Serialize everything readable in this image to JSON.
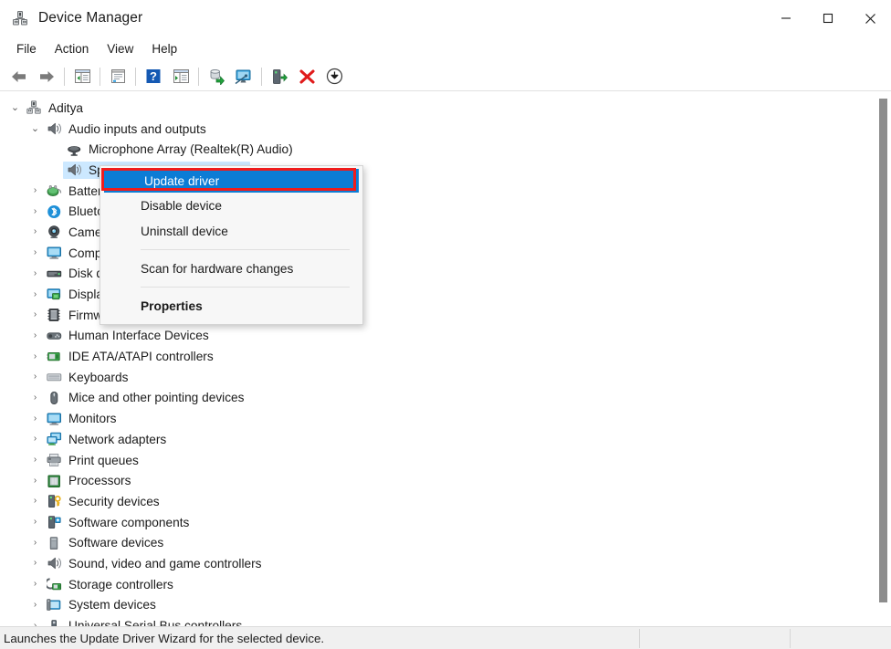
{
  "window": {
    "title": "Device Manager",
    "icon": "device-manager-icon",
    "minimize_label": "─",
    "maximize_label": "☐",
    "close_label": "✕"
  },
  "menubar": {
    "items": [
      {
        "label": "File"
      },
      {
        "label": "Action"
      },
      {
        "label": "View"
      },
      {
        "label": "Help"
      }
    ]
  },
  "toolbar": {
    "buttons": [
      {
        "name": "back-arrow-icon",
        "tip": "Back"
      },
      {
        "name": "forward-arrow-icon",
        "tip": "Forward"
      },
      {
        "name": "show-hide-console-tree-icon",
        "tip": "Show/Hide Console Tree"
      },
      {
        "name": "properties-icon",
        "tip": "Properties"
      },
      {
        "name": "help-icon",
        "tip": "Help"
      },
      {
        "name": "action-pane-icon",
        "tip": "Show/Hide Action Pane"
      },
      {
        "name": "update-driver-icon",
        "tip": "Update driver"
      },
      {
        "name": "scan-hardware-changes-icon",
        "tip": "Scan for hardware changes"
      },
      {
        "name": "enable-device-icon",
        "tip": "Enable device"
      },
      {
        "name": "uninstall-device-icon",
        "tip": "Uninstall device"
      },
      {
        "name": "download-icon",
        "tip": "Download"
      }
    ]
  },
  "tree": {
    "nodes": [
      {
        "label": "Aditya",
        "depth": 0,
        "chevron": "down",
        "icon": "computer-icon",
        "selected": false
      },
      {
        "label": "Audio inputs and outputs",
        "depth": 1,
        "chevron": "down",
        "icon": "speaker-icon",
        "selected": false
      },
      {
        "label": "Microphone Array (Realtek(R) Audio)",
        "depth": 2,
        "chevron": "none",
        "icon": "microphone-icon",
        "selected": false
      },
      {
        "label": "Speakers (Realtek(R) Audio)",
        "depth": 2,
        "chevron": "none",
        "icon": "speaker-icon",
        "selected": true
      },
      {
        "label": "Batteries",
        "depth": 1,
        "chevron": "right",
        "icon": "battery-icon",
        "selected": false
      },
      {
        "label": "Bluetooth",
        "depth": 1,
        "chevron": "right",
        "icon": "bluetooth-icon",
        "selected": false
      },
      {
        "label": "Cameras",
        "depth": 1,
        "chevron": "right",
        "icon": "camera-icon",
        "selected": false
      },
      {
        "label": "Computer",
        "depth": 1,
        "chevron": "right",
        "icon": "monitor-icon",
        "selected": false
      },
      {
        "label": "Disk drives",
        "depth": 1,
        "chevron": "right",
        "icon": "disk-drive-icon",
        "selected": false
      },
      {
        "label": "Display adapters",
        "depth": 1,
        "chevron": "right",
        "icon": "display-adapter-icon",
        "selected": false
      },
      {
        "label": "Firmware",
        "depth": 1,
        "chevron": "right",
        "icon": "firmware-icon",
        "selected": false
      },
      {
        "label": "Human Interface Devices",
        "depth": 1,
        "chevron": "right",
        "icon": "hid-icon",
        "selected": false
      },
      {
        "label": "IDE ATA/ATAPI controllers",
        "depth": 1,
        "chevron": "right",
        "icon": "ide-controller-icon",
        "selected": false
      },
      {
        "label": "Keyboards",
        "depth": 1,
        "chevron": "right",
        "icon": "keyboard-icon",
        "selected": false
      },
      {
        "label": "Mice and other pointing devices",
        "depth": 1,
        "chevron": "right",
        "icon": "mouse-icon",
        "selected": false
      },
      {
        "label": "Monitors",
        "depth": 1,
        "chevron": "right",
        "icon": "monitor-icon",
        "selected": false
      },
      {
        "label": "Network adapters",
        "depth": 1,
        "chevron": "right",
        "icon": "network-adapter-icon",
        "selected": false
      },
      {
        "label": "Print queues",
        "depth": 1,
        "chevron": "right",
        "icon": "printer-icon",
        "selected": false
      },
      {
        "label": "Processors",
        "depth": 1,
        "chevron": "right",
        "icon": "processor-icon",
        "selected": false
      },
      {
        "label": "Security devices",
        "depth": 1,
        "chevron": "right",
        "icon": "security-device-icon",
        "selected": false
      },
      {
        "label": "Software components",
        "depth": 1,
        "chevron": "right",
        "icon": "software-component-icon",
        "selected": false
      },
      {
        "label": "Software devices",
        "depth": 1,
        "chevron": "right",
        "icon": "software-device-icon",
        "selected": false
      },
      {
        "label": "Sound, video and game controllers",
        "depth": 1,
        "chevron": "right",
        "icon": "sound-controller-icon",
        "selected": false
      },
      {
        "label": "Storage controllers",
        "depth": 1,
        "chevron": "right",
        "icon": "storage-controller-icon",
        "selected": false
      },
      {
        "label": "System devices",
        "depth": 1,
        "chevron": "right",
        "icon": "system-device-icon",
        "selected": false
      },
      {
        "label": "Universal Serial Bus controllers",
        "depth": 1,
        "chevron": "right",
        "icon": "usb-icon",
        "selected": false
      }
    ]
  },
  "context_menu": {
    "items": [
      {
        "label": "Update driver",
        "highlighted": true,
        "bold": false,
        "separator_after": false
      },
      {
        "label": "Disable device",
        "highlighted": false,
        "bold": false,
        "separator_after": false
      },
      {
        "label": "Uninstall device",
        "highlighted": false,
        "bold": false,
        "separator_after": true
      },
      {
        "label": "Scan for hardware changes",
        "highlighted": false,
        "bold": false,
        "separator_after": true
      },
      {
        "label": "Properties",
        "highlighted": false,
        "bold": true,
        "separator_after": false
      }
    ]
  },
  "statusbar": {
    "text": "Launches the Update Driver Wizard for the selected device."
  },
  "colors": {
    "selection_blue": "#0c7cd5",
    "row_select_fill": "#cce8ff",
    "annotation_red": "#ef1c1c",
    "statusbar_bg": "#f0f0f0"
  }
}
